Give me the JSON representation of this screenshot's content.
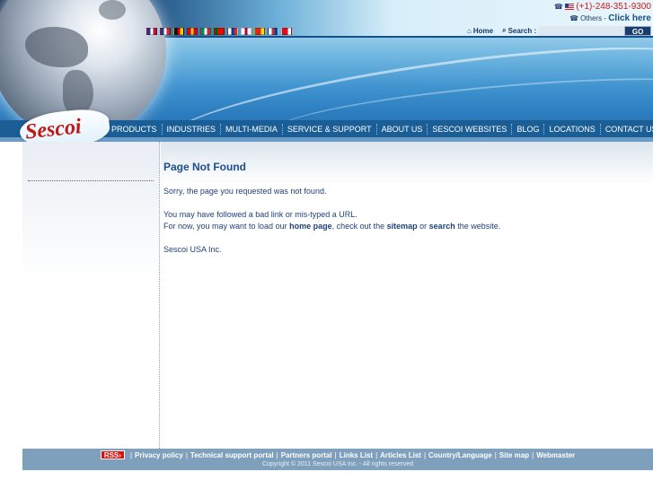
{
  "header": {
    "phone": "(+1)-248-351-9300",
    "others_label": "Others - ",
    "click_here": "Click here",
    "home": "Home",
    "search_label": "Search :",
    "search_value": "",
    "go": "GO",
    "flags": [
      {
        "name": "flag-uk",
        "colors": [
          "#1f3a8f",
          "#ffffff",
          "#c8102e"
        ]
      },
      {
        "name": "flag-france",
        "colors": [
          "#1f3a8f",
          "#ffffff",
          "#d22"
        ]
      },
      {
        "name": "flag-germany",
        "colors": [
          "#111111",
          "#dd0000",
          "#ffce00"
        ]
      },
      {
        "name": "flag-spain",
        "colors": [
          "#c60b1e",
          "#ffc400",
          "#c60b1e"
        ]
      },
      {
        "name": "flag-italy",
        "colors": [
          "#009246",
          "#ffffff",
          "#ce2b37"
        ]
      },
      {
        "name": "flag-portugal",
        "colors": [
          "#006600",
          "#ff0000",
          "#ff0000"
        ]
      },
      {
        "name": "flag-russia",
        "colors": [
          "#ffffff",
          "#0039a6",
          "#d52b1e"
        ]
      },
      {
        "name": "flag-japan",
        "colors": [
          "#ffffff",
          "#bc002d",
          "#ffffff"
        ]
      },
      {
        "name": "flag-china",
        "colors": [
          "#de2910",
          "#de2910",
          "#ffde00"
        ]
      },
      {
        "name": "flag-korea",
        "colors": [
          "#ffffff",
          "#cd2e3a",
          "#0047a0"
        ]
      },
      {
        "name": "flag-turkey",
        "colors": [
          "#e30a17",
          "#e30a17",
          "#ffffff"
        ]
      }
    ]
  },
  "logo": "Sescoi",
  "nav": [
    "PRODUCTS",
    "INDUSTRIES",
    "MULTI-MEDIA",
    "SERVICE & SUPPORT",
    "ABOUT US",
    "SESCOI WEBSITES",
    "BLOG",
    "LOCATIONS",
    "CONTACT US"
  ],
  "main": {
    "title": "Page Not Found",
    "p1": "Sorry, the page you requested was not found.",
    "p2_line1": "You may have followed a bad link or mis-typed a URL.",
    "p2_pre": "For now, you may want to load our ",
    "home_page": "home page",
    "p2_mid1": ", check out the ",
    "sitemap": "sitemap",
    "p2_mid2": " or ",
    "search": "search",
    "p2_end": " the website.",
    "signature": "Sescoi USA Inc."
  },
  "footer": {
    "rss": "RSS",
    "links": [
      "Privacy policy",
      "Technical support portal",
      "Partners portal",
      "Links List",
      "Articles List",
      "Country/Language",
      "Site map",
      "Webmaster"
    ],
    "copyright": "Copyright © 2011 Sescoi USA Inc. - All rights reserved"
  },
  "colors": {
    "nav_bg": "#1b5e96",
    "accent_red": "#c01818",
    "title_blue": "#1f4e8b",
    "footer_bg": "#7fa0bd"
  }
}
